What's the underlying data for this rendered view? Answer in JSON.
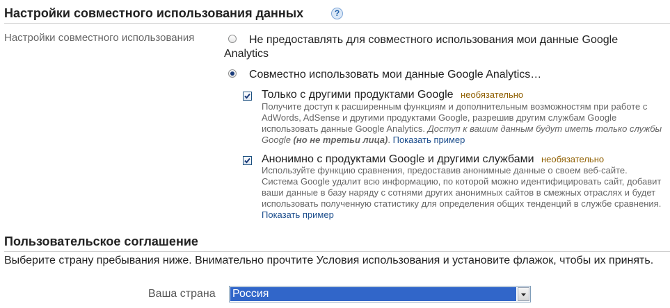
{
  "sharing": {
    "title": "Настройки совместного использования данных",
    "help_icon": "help-icon",
    "row_label": "Настройки совместного использования",
    "option_none": "Не предоставлять для совместного использования мои данные Google Analytics",
    "option_share": "Совместно использовать мои данные Google Analytics…",
    "sub1": {
      "title": "Только с другими продуктами Google",
      "optional": "необязательно",
      "desc_plain": "Получите доступ к расширенным функциям и дополнительным возможностям при работе с AdWords, AdSense и другими продуктами Google, разрешив другим службам Google использовать данные Google Analytics.",
      "desc_italic": "Доступ к вашим данным будут иметь только службы Google",
      "desc_bold_italic": "(но не третьи лица)",
      "link": "Показать пример"
    },
    "sub2": {
      "title": "Анонимно с продуктами Google и другими службами",
      "optional": "необязательно",
      "desc_plain": "Используйте функцию сравнения, предоставив анонимные данные о своем веб-сайте. Система Google удалит всю информацию, по которой можно идентифицировать сайт, добавит ваши данные в базу наряду с сотнями других анонимных сайтов в смежных отраслях и будет использовать полученную статистику для определения общих тенденций в службе сравнения.",
      "link": "Показать пример"
    }
  },
  "agreement": {
    "title": "Пользовательское соглашение",
    "instructions": "Выберите страну пребывания ниже. Внимательно прочтите Условия использования и установите флажок, чтобы их принять.",
    "country_label": "Ваша страна",
    "country_value": "Россия"
  }
}
